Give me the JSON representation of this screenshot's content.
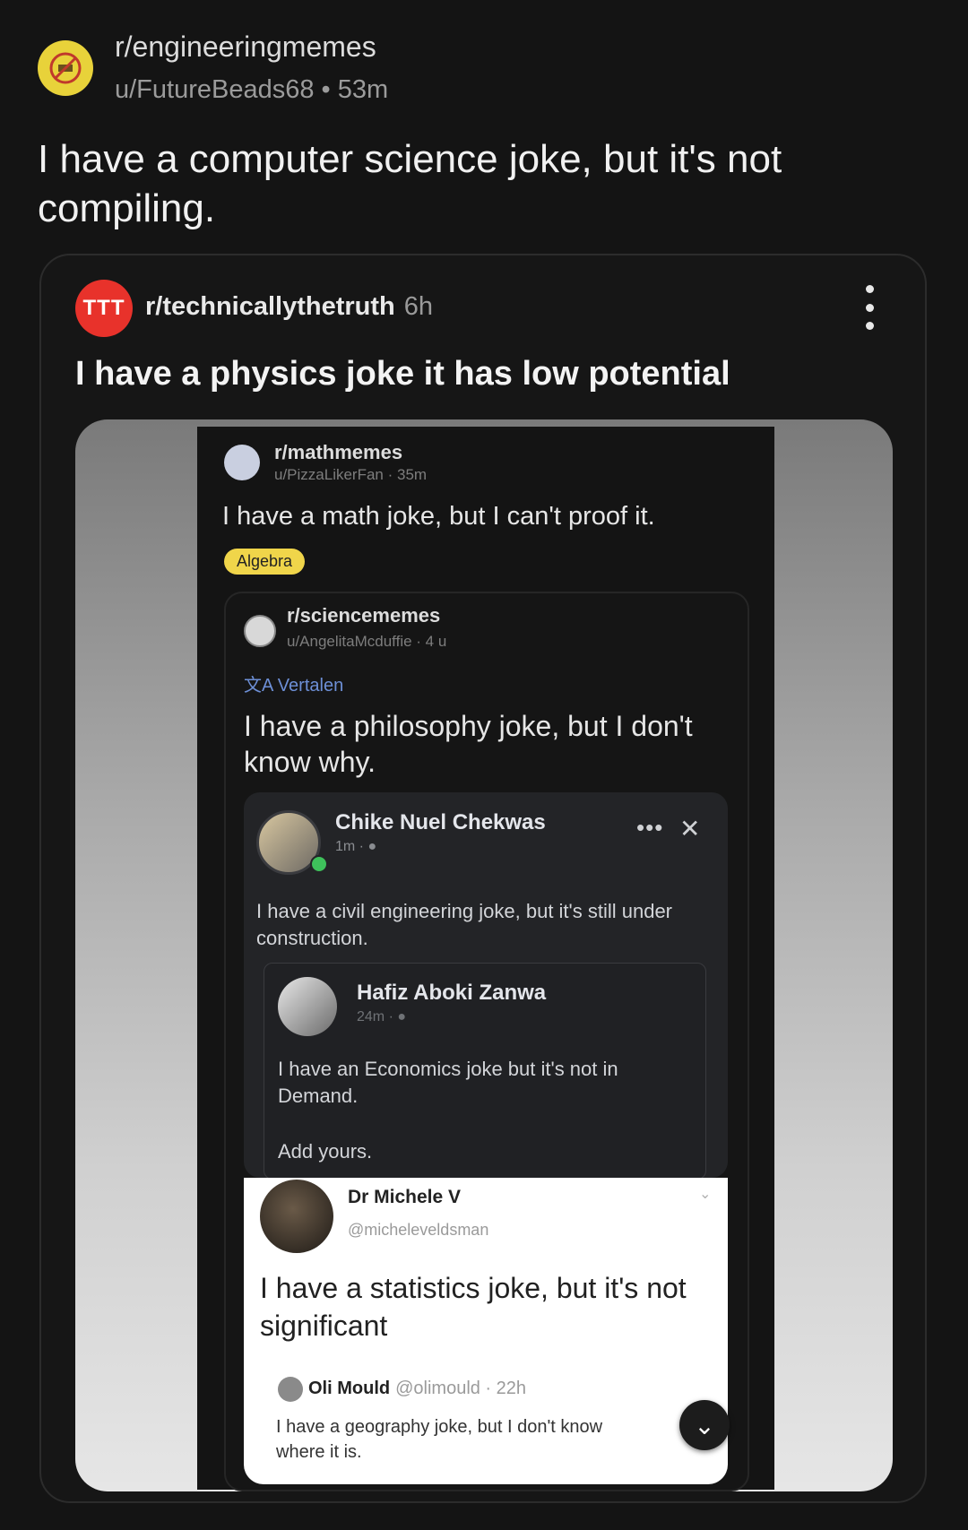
{
  "post": {
    "subreddit": "r/engineeringmemes",
    "author": "u/FutureBeads68",
    "age": "53m",
    "title": "I have a computer science joke, but it's not compiling."
  },
  "crosspost": {
    "avatar_text": "TTT",
    "subreddit": "r/technicallythetruth",
    "age": "6h",
    "title": "I have a physics joke it has low potential",
    "more_icon": "vertical-ellipsis-icon"
  },
  "image": {
    "math": {
      "subreddit": "r/mathmemes",
      "meta": "u/PizzaLikerFan · 35m",
      "title": "I have a math joke, but I can't proof it.",
      "flair": "Algebra"
    },
    "science": {
      "subreddit": "r/sciencememes",
      "meta": "u/AngelitaMcduffie · 4 u",
      "translate": "Vertalen",
      "title": "I have a philosophy joke, but I don't know why."
    },
    "facebook": {
      "name": "Chike Nuel Chekwas",
      "meta": "1m · ●",
      "dots": "•••",
      "close": "✕",
      "text": "I have a civil engineering joke, but it's still under construction."
    },
    "shared": {
      "name": "Hafiz Aboki Zanwa",
      "meta": "24m · ●",
      "text": "I have an Economics joke but it's not in Demand.",
      "add_yours": "Add yours."
    },
    "tweet": {
      "name": "Dr Michele V",
      "handle": "@micheleveldsman",
      "chevron": "⌄",
      "text": "I have a statistics joke, but it's not significant",
      "reply_name": "Oli Mould",
      "reply_meta": "@olimould · 22h",
      "reply_text": "I have a geography joke, but I don't know where it is."
    },
    "scroll_icon": "⌄"
  }
}
